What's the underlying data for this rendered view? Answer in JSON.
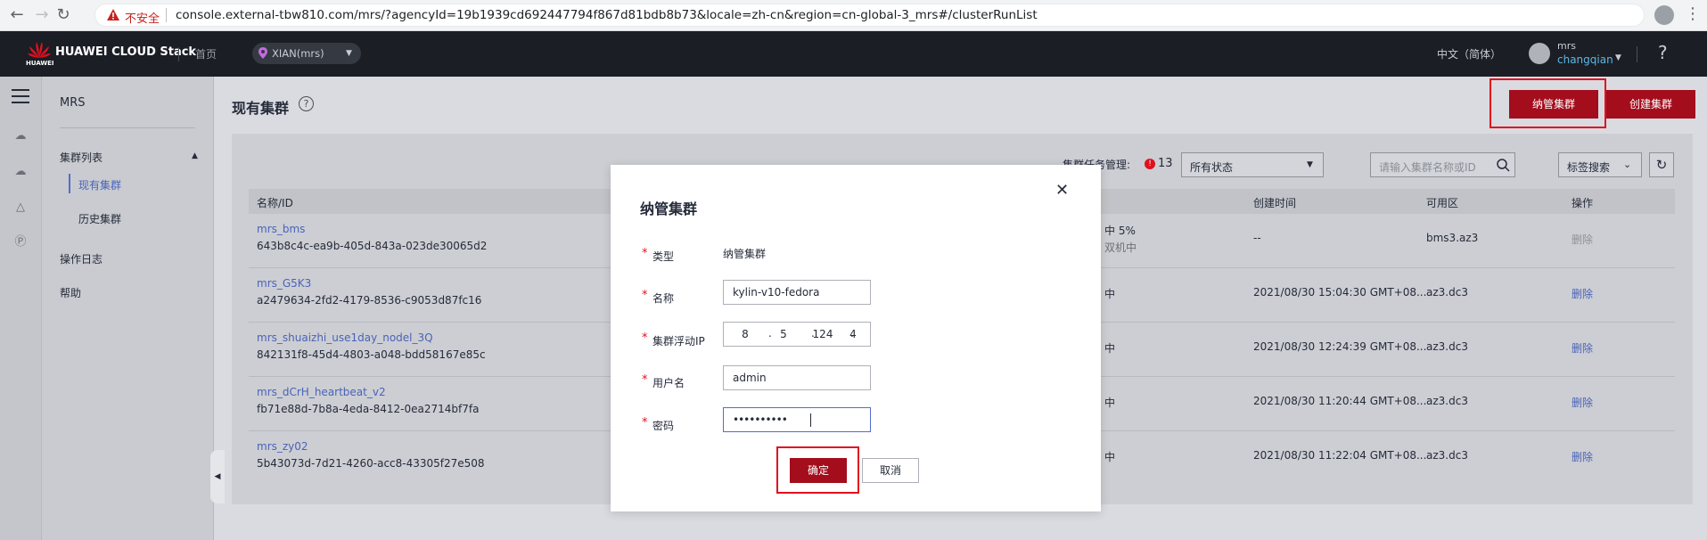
{
  "browser": {
    "insecure_label": "不安全",
    "url": "console.external-tbw810.com/mrs/?agencyId=19b1939cd692447794f867d81bdb8b73&locale=zh-cn&region=cn-global-3_mrs#/clusterRunList"
  },
  "header": {
    "logo_text": "HUAWEI",
    "brand": "HUAWEI CLOUD Stack",
    "home": "首页",
    "region": "XIAN(mrs)",
    "language": "中文（简体）",
    "user_name": "mrs",
    "user_account": "changqian",
    "help": "?"
  },
  "sidebar": {
    "title": "MRS",
    "group": "集群列表",
    "sub_items": [
      {
        "label": "现有集群",
        "active": true
      },
      {
        "label": "历史集群",
        "active": false
      }
    ],
    "items": [
      "操作日志",
      "帮助"
    ]
  },
  "main": {
    "title": "现有集群",
    "manage_button": "纳管集群",
    "create_button": "创建集群",
    "toolbar": {
      "task_label": "集群任务管理:",
      "task_count": "13",
      "status_select": "所有状态",
      "search_placeholder": "请输入集群名称或ID",
      "tag_search": "标签搜索"
    },
    "columns": [
      "名称/ID",
      "创建时间",
      "可用区",
      "操作"
    ],
    "rows": [
      {
        "name": "mrs_bms",
        "id": "643b8c4c-ea9b-405d-843a-023de30065d2",
        "status": "中 5%",
        "status_sub": "双机中",
        "time": "--",
        "az": "bms3.az3",
        "action": "删除"
      },
      {
        "name": "mrs_G5K3",
        "id": "a2479634-2fd2-4179-8536-c9053d87fc16",
        "status": "中",
        "status_sub": "",
        "time": "2021/08/30 15:04:30 GMT+08...",
        "az": "az3.dc3",
        "action": "删除"
      },
      {
        "name": "mrs_shuaizhi_use1day_nodel_3Q",
        "id": "842131f8-45d4-4803-a048-bdd58167e85c",
        "status": "中",
        "status_sub": "",
        "time": "2021/08/30 12:24:39 GMT+08...",
        "az": "az3.dc3",
        "action": "删除"
      },
      {
        "name": "mrs_dCrH_heartbeat_v2",
        "id": "fb71e88d-7b8a-4eda-8412-0ea2714bf7fa",
        "status": "中",
        "status_sub": "",
        "time": "2021/08/30 11:20:44 GMT+08...",
        "az": "az3.dc3",
        "action": "删除"
      },
      {
        "name": "mrs_zy02",
        "id": "5b43073d-7d21-4260-acc8-43305f27e508",
        "status": "中",
        "status_sub": "",
        "time": "2021/08/30 11:22:04 GMT+08...",
        "az": "az3.dc3",
        "action": "删除"
      }
    ]
  },
  "dialog": {
    "title": "纳管集群",
    "type_label": "类型",
    "type_value": "纳管集群",
    "name_label": "名称",
    "name_value": "kylin-v10-fedora",
    "ip_label": "集群浮动IP",
    "ip_octets": [
      "8",
      "5",
      "124",
      "4"
    ],
    "user_label": "用户名",
    "user_value": "admin",
    "password_label": "密码",
    "password_value": "••••••••••",
    "confirm": "确定",
    "cancel": "取消"
  },
  "colors": {
    "brand_red": "#a30d1c",
    "highlight": "#e0101e",
    "link_blue": "#4a63b8",
    "header_bg": "#1b1e24"
  }
}
